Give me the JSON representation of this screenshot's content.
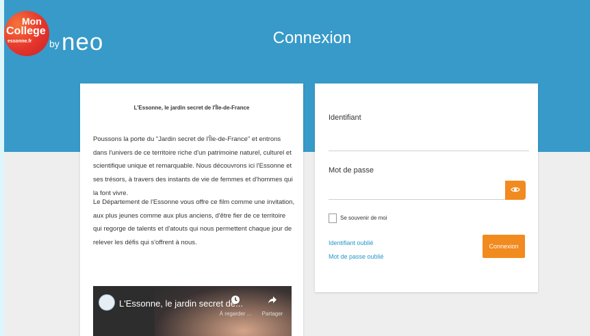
{
  "header": {
    "logo": {
      "line1": "Mon",
      "line2": "College",
      "line3": "essonne.fr",
      "by": "by",
      "brand": "neo"
    },
    "title": "Connexion"
  },
  "info_card": {
    "title": "L'Essonne, le jardin secret de l'Île-de-France",
    "paragraphs": [
      "Poussons la porte du \"Jardin secret de l'Île-de-France\" et entrons dans l'univers de ce territoire riche d'un patrimoine naturel, culturel et scientifique unique et remarquable. Nous découvrons ici l'Essonne et ses trésors, à travers des instants de vie de femmes et d'hommes qui la font vivre.",
      "Le Département de l'Essonne vous offre ce film comme une invitation, aux plus jeunes comme aux plus anciens, d'être fier de ce territoire qui regorge de talents et d'atouts qui nous permettent chaque jour de relever les défis qui s'offrent à nous."
    ],
    "video": {
      "title": "L'Essonne, le jardin secret de...",
      "watch_later": "À regarder ...",
      "share": "Partager"
    }
  },
  "login": {
    "identifier_label": "Identifiant",
    "identifier_value": "",
    "password_label": "Mot de passe",
    "password_value": "",
    "remember_label": "Se souvenir de moi",
    "remember_checked": false,
    "forgot_identifier": "Identifiant oublié",
    "forgot_password": "Mot de passe oublié",
    "submit": "Connexion"
  },
  "colors": {
    "header_bg": "#379ac9",
    "accent": "#f18a1f",
    "link": "#2596c8",
    "page_bg": "#eeeeef"
  },
  "icons": [
    "eye-icon",
    "clock-icon",
    "share-icon",
    "channel-logo"
  ]
}
